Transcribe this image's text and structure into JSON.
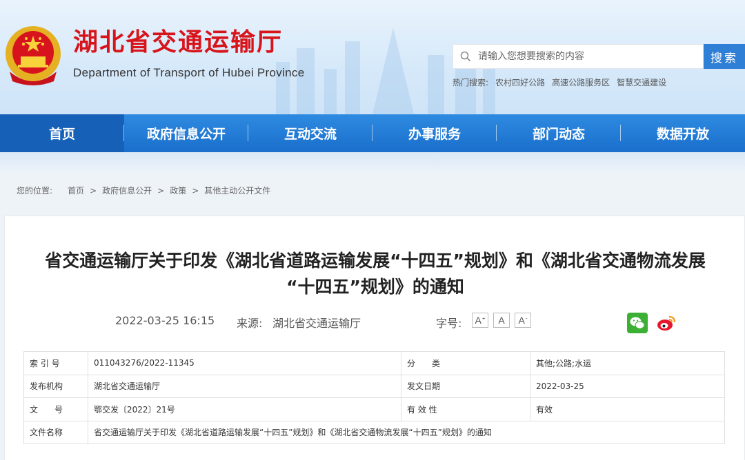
{
  "header": {
    "site_title": "湖北省交通运输厅",
    "site_subtitle": "Department of Transport of Hubei Province",
    "search_placeholder": "请输入您想要搜索的内容",
    "search_button": "搜索",
    "hot_label": "热门搜索:",
    "hot_links": [
      "农村四好公路",
      "高速公路服务区",
      "智慧交通建设"
    ]
  },
  "nav": {
    "items": [
      "首页",
      "政府信息公开",
      "互动交流",
      "办事服务",
      "部门动态",
      "数据开放"
    ]
  },
  "breadcrumb": {
    "label": "您的位置:",
    "items": [
      "首页",
      "政府信息公开",
      "政策",
      "其他主动公开文件"
    ],
    "separator": ">"
  },
  "article": {
    "title_line1": "省交通运输厅关于印发《湖北省道路运输发展“十四五”规划》和《湖北省交通物流发展",
    "title_line2": "“十四五”规划》的通知",
    "datetime": "2022-03-25 16:15",
    "source_label": "来源:",
    "source": "湖北省交通运输厅",
    "font_size_label": "字号:",
    "font_buttons": [
      "A",
      "A",
      "A"
    ]
  },
  "info_table": {
    "rows": [
      {
        "l1": "索 引 号",
        "v1": "011043276/2022-11345",
        "l2": "分　　类",
        "v2": "其他;公路;水运"
      },
      {
        "l1": "发布机构",
        "v1": "湖北省交通运输厅",
        "l2": "发文日期",
        "v2": "2022-03-25"
      },
      {
        "l1": "文　　号",
        "v1": "鄂交发〔2022〕21号",
        "l2": "有 效 性",
        "v2": "有效"
      }
    ],
    "name_label": "文件名称",
    "name_value": "省交通运输厅关于印发《湖北省道路运输发展“十四五”规划》和《湖北省交通物流发展“十四五”规划》的通知"
  },
  "colors": {
    "title_red": "#d8141b",
    "nav_blue": "#1a6fcc",
    "search_blue": "#2f7fd6"
  },
  "icons": [
    "national-emblem-icon",
    "search-icon",
    "wechat-icon",
    "weibo-icon"
  ]
}
